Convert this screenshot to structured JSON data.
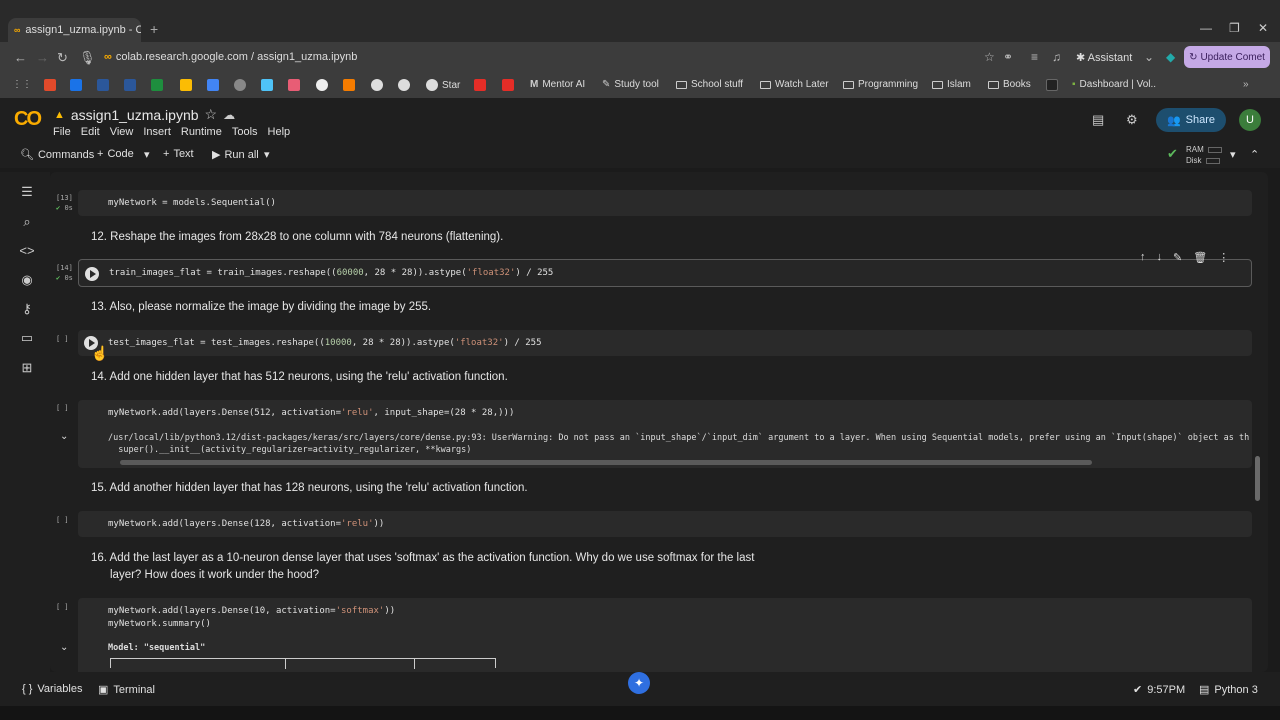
{
  "browser": {
    "tab_title": "assign1_uzma.ipynb - Col",
    "url": "colab.research.google.com / assign1_uzma.ipynb",
    "assistant_label": "Assistant",
    "update_label": "Update Comet",
    "bookmarks": [
      "Star",
      "Mentor AI",
      "Study tool",
      "School stuff",
      "Watch Later",
      "Programming",
      "Islam",
      "Books",
      "Dashboard | Vol.."
    ]
  },
  "colab": {
    "logo": "CO",
    "notebook_title": "assign1_uzma.ipynb",
    "menu": [
      "File",
      "Edit",
      "View",
      "Insert",
      "Runtime",
      "Tools",
      "Help"
    ],
    "share_label": "Share",
    "avatar_letter": "U",
    "toolbar": {
      "commands": "Commands",
      "code": "Code",
      "text": "Text",
      "run_all": "Run all",
      "ram_label": "RAM",
      "disk_label": "Disk"
    }
  },
  "cells": {
    "c1": {
      "exec": "[13]",
      "time": "0s",
      "code": "myNetwork = models.Sequential()"
    },
    "m12": "12. Reshape the images from 28x28 to one column with 784 neurons (flattening).",
    "c2": {
      "exec": "[14]",
      "time": "0s",
      "code_a": "train_images_flat = train_images.reshape((",
      "num1": "60000",
      "code_b": ", 28 * 28)).astype(",
      "str1": "'float32'",
      "code_c": ") / 255"
    },
    "m13": "13. Also, please normalize the image by dividing the image by 255.",
    "c3": {
      "exec": "[ ]",
      "code_a": "test_images_flat = test_images.reshape((",
      "num1": "10000",
      "code_b": ", 28 * 28)).astype(",
      "str1": "'float32'",
      "code_c": ") / 255"
    },
    "m14": "14. Add one hidden layer that has 512 neurons, using the 'relu' activation function.",
    "c4": {
      "exec": "[ ]",
      "code_a": "myNetwork.add(layers.Dense(512, activation=",
      "str1": "'relu'",
      "code_b": ", input_shape=(28 * 28,)))",
      "output1": "/usr/local/lib/python3.12/dist-packages/keras/src/layers/core/dense.py:93: UserWarning: Do not pass an `input_shape`/`input_dim` argument to a layer. When using Sequential models, prefer using an `Input(shape)` object as th",
      "output2": "  super().__init__(activity_regularizer=activity_regularizer, **kwargs)"
    },
    "m15": "15. Add another hidden layer that has 128 neurons, using the 'relu' activation function.",
    "c5": {
      "exec": "[ ]",
      "code_a": "myNetwork.add(layers.Dense(128, activation=",
      "str1": "'relu'",
      "code_b": "))"
    },
    "m16a": "16. Add the last layer as a 10-neuron dense layer that uses 'softmax' as the activation function. Why do we use softmax for the last",
    "m16b": "layer? How does it work under the hood?",
    "c6": {
      "exec": "[ ]",
      "code_a": "myNetwork.add(layers.Dense(10, activation=",
      "str1": "'softmax'",
      "code_b": "))",
      "code_line2": "myNetwork.summary()",
      "output1": "Model: \"sequential\""
    }
  },
  "status": {
    "variables": "Variables",
    "terminal": "Terminal",
    "time": "9:57PM",
    "kernel": "Python 3"
  }
}
